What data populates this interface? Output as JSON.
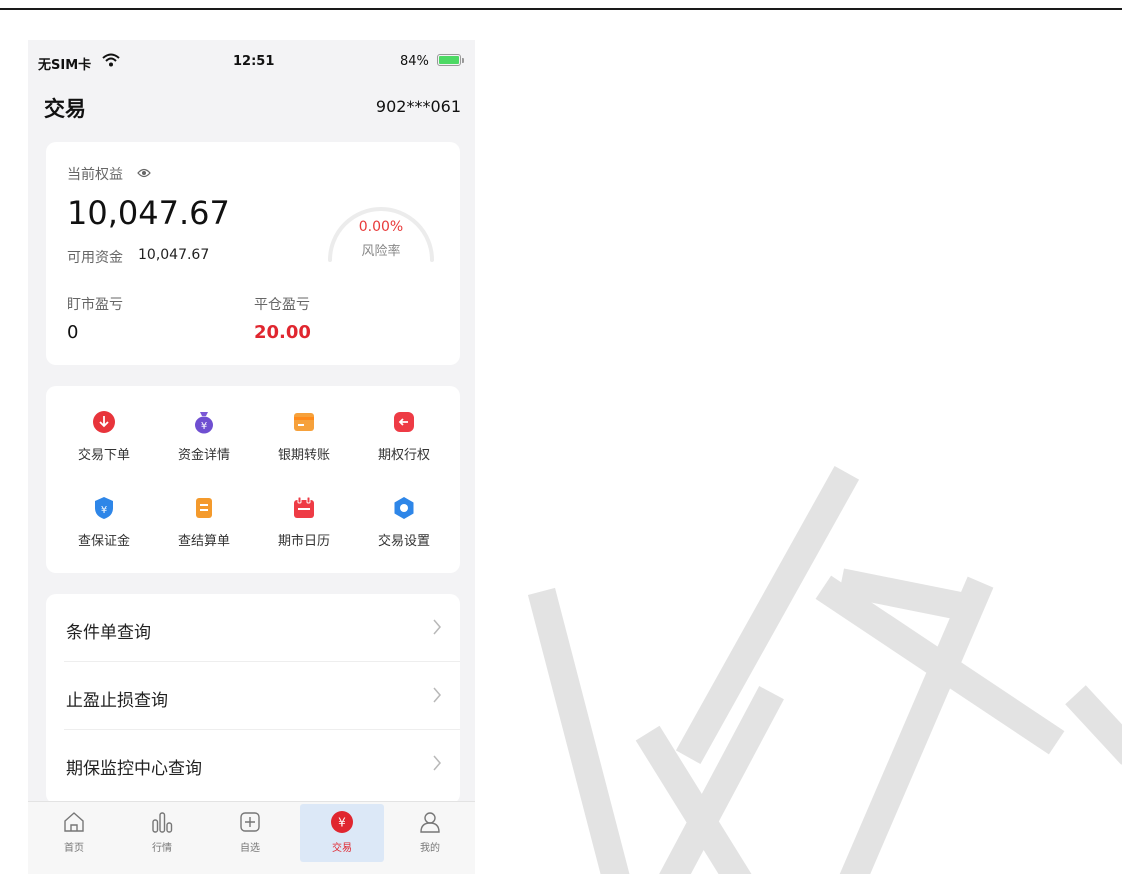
{
  "status_bar": {
    "carrier": "无SIM卡",
    "time": "12:51",
    "battery": "84%"
  },
  "header": {
    "title": "交易",
    "account": "902***061"
  },
  "equity": {
    "label": "当前权益",
    "value": "10,047.67",
    "available_label": "可用资金",
    "available_value": "10,047.67",
    "risk_rate": "0.00%",
    "risk_label": "风险率",
    "mark_pnl_label": "盯市盈亏",
    "mark_pnl_value": "0",
    "close_pnl_label": "平仓盈亏",
    "close_pnl_value": "20.00"
  },
  "functions": [
    {
      "label": "交易下单",
      "icon": "order-down-icon"
    },
    {
      "label": "资金详情",
      "icon": "money-bag-icon"
    },
    {
      "label": "银期转账",
      "icon": "card-icon"
    },
    {
      "label": "期权行权",
      "icon": "exercise-icon"
    },
    {
      "label": "查保证金",
      "icon": "shield-yen-icon"
    },
    {
      "label": "查结算单",
      "icon": "document-icon"
    },
    {
      "label": "期市日历",
      "icon": "calendar-icon"
    },
    {
      "label": "交易设置",
      "icon": "gear-icon"
    }
  ],
  "list": [
    {
      "label": "条件单查询"
    },
    {
      "label": "止盈止损查询"
    },
    {
      "label": "期保监控中心查询"
    }
  ],
  "tabs": [
    {
      "label": "首页",
      "icon": "home-icon"
    },
    {
      "label": "行情",
      "icon": "market-bars-icon"
    },
    {
      "label": "自选",
      "icon": "add-square-icon"
    },
    {
      "label": "交易",
      "icon": "trade-yen-icon"
    },
    {
      "label": "我的",
      "icon": "profile-icon"
    }
  ],
  "colors": {
    "accent_red": "#e0262f",
    "active_tab_bg": "#dce8f7",
    "battery_green": "#4cd964"
  }
}
